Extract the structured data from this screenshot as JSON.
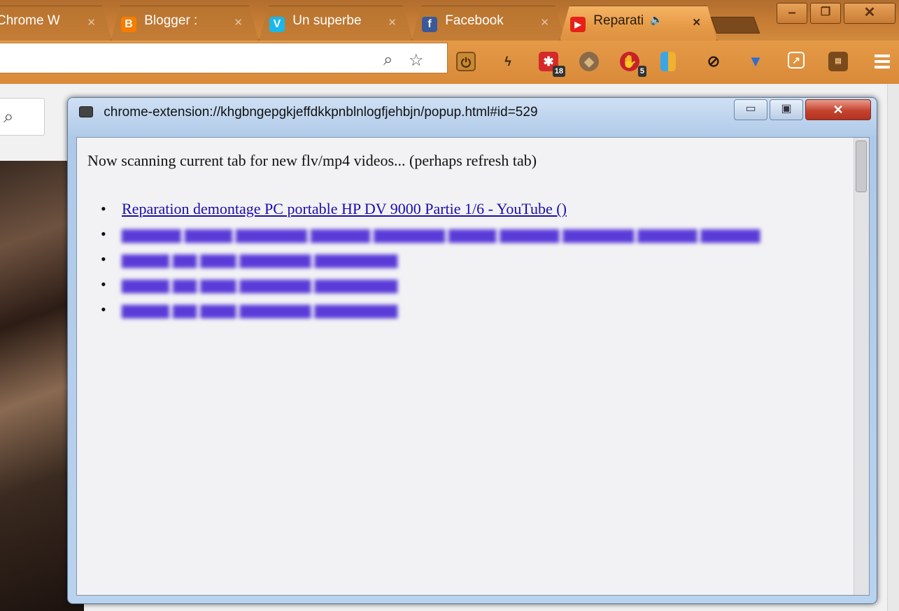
{
  "tabs": [
    {
      "title": "Chrome W",
      "favicon": "chrome-icon",
      "favicon_color": "#8a8a8a"
    },
    {
      "title": "Blogger : ",
      "favicon": "blogger-icon",
      "favicon_color": "#f57d00"
    },
    {
      "title": "Un superbe",
      "favicon": "vimeo-icon",
      "favicon_color": "#1ab7ea"
    },
    {
      "title": "Facebook",
      "favicon": "facebook-icon",
      "favicon_color": "#3b5998"
    },
    {
      "title": "Reparati",
      "favicon": "youtube-icon",
      "favicon_color": "#e62117",
      "active": true,
      "audio": "🔈"
    }
  ],
  "toolbar": {
    "extension_badges": {
      "ext_3": "18",
      "ext_5": "5"
    }
  },
  "popup": {
    "title": "chrome-extension://khgbngepgkjeffdkkpnblnlogfjehbjn/popup.html#id=529",
    "status": "Now scanning current tab for new flv/mp4 videos... (perhaps refresh tab)",
    "videos": [
      {
        "label": "Reparation demontage PC portable HP DV 9000 Partie 1/6 - YouTube ()",
        "blurred": false
      }
    ]
  },
  "colors": {
    "link": "#1a0dab",
    "chrome_frame": "#d98a38",
    "window_close": "#c4432e"
  }
}
